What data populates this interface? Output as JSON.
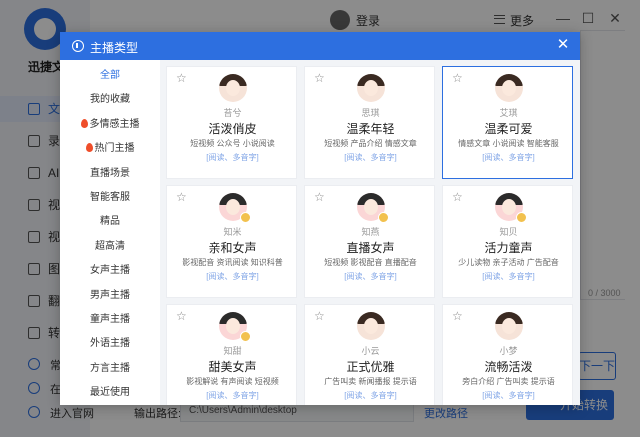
{
  "app": {
    "name": "迅捷文",
    "sidebar": [
      "文",
      "录",
      "AI",
      "视",
      "视",
      "图",
      "翻",
      "转"
    ],
    "bottom_links": [
      "常",
      "在",
      "进入官网"
    ]
  },
  "topbar": {
    "login": "登录",
    "more": "更多",
    "minimize": "—",
    "maximize": "☐",
    "close": "✕"
  },
  "editor": {
    "char_count": "0 / 3000",
    "next_button": "下一下"
  },
  "output": {
    "label": "输出路径:",
    "path": "C:\\Users\\Admin\\desktop",
    "change": "更改路径",
    "convert": "开始转换"
  },
  "modal": {
    "title": "主播类型",
    "close": "✕",
    "categories": [
      {
        "label": "全部",
        "active": true,
        "hot": false
      },
      {
        "label": "我的收藏",
        "active": false,
        "hot": false
      },
      {
        "label": "多情感主播",
        "active": false,
        "hot": true
      },
      {
        "label": "热门主播",
        "active": false,
        "hot": true
      },
      {
        "label": "直播场景",
        "active": false,
        "hot": false
      },
      {
        "label": "智能客服",
        "active": false,
        "hot": false
      },
      {
        "label": "精品",
        "active": false,
        "hot": false
      },
      {
        "label": "超高清",
        "active": false,
        "hot": false
      },
      {
        "label": "女声主播",
        "active": false,
        "hot": false
      },
      {
        "label": "男声主播",
        "active": false,
        "hot": false
      },
      {
        "label": "童声主播",
        "active": false,
        "hot": false
      },
      {
        "label": "外语主播",
        "active": false,
        "hot": false
      },
      {
        "label": "方言主播",
        "active": false,
        "hot": false
      },
      {
        "label": "最近使用",
        "active": false,
        "hot": false
      }
    ],
    "voices": [
      {
        "nick": "苔兮",
        "style": "活泼俏皮",
        "tags": "短视频  公众号  小说阅读",
        "features": "[阅读、多音字]",
        "badge": false,
        "selected": false
      },
      {
        "nick": "思琪",
        "style": "温柔年轻",
        "tags": "短视频  产品介绍  情感文章",
        "features": "[阅读、多音字]",
        "badge": false,
        "selected": false
      },
      {
        "nick": "艾琪",
        "style": "温柔可爱",
        "tags": "情感文章  小说阅读  智能客服",
        "features": "[阅读、多音字]",
        "badge": false,
        "selected": true
      },
      {
        "nick": "知米",
        "style": "亲和女声",
        "tags": "影视配音  资讯阅读  知识科普",
        "features": "[阅读、多音字]",
        "badge": true,
        "selected": false
      },
      {
        "nick": "知燕",
        "style": "直播女声",
        "tags": "短视频  影视配音  直播配音",
        "features": "[阅读、多音字]",
        "badge": true,
        "selected": false
      },
      {
        "nick": "知贝",
        "style": "活力童声",
        "tags": "少儿读物  亲子活动  广告配音",
        "features": "[阅读、多音字]",
        "badge": true,
        "selected": false
      },
      {
        "nick": "知甜",
        "style": "甜美女声",
        "tags": "影视解说  有声阅读  短视频",
        "features": "[阅读、多音字]",
        "badge": true,
        "selected": false
      },
      {
        "nick": "小云",
        "style": "正式优雅",
        "tags": "广告叫卖  新闻播报  提示语",
        "features": "[阅读、多音字]",
        "badge": false,
        "selected": false
      },
      {
        "nick": "小梦",
        "style": "流畅活泼",
        "tags": "旁白介绍  广告叫卖  提示语",
        "features": "[阅读、多音字]",
        "badge": false,
        "selected": false
      }
    ]
  }
}
